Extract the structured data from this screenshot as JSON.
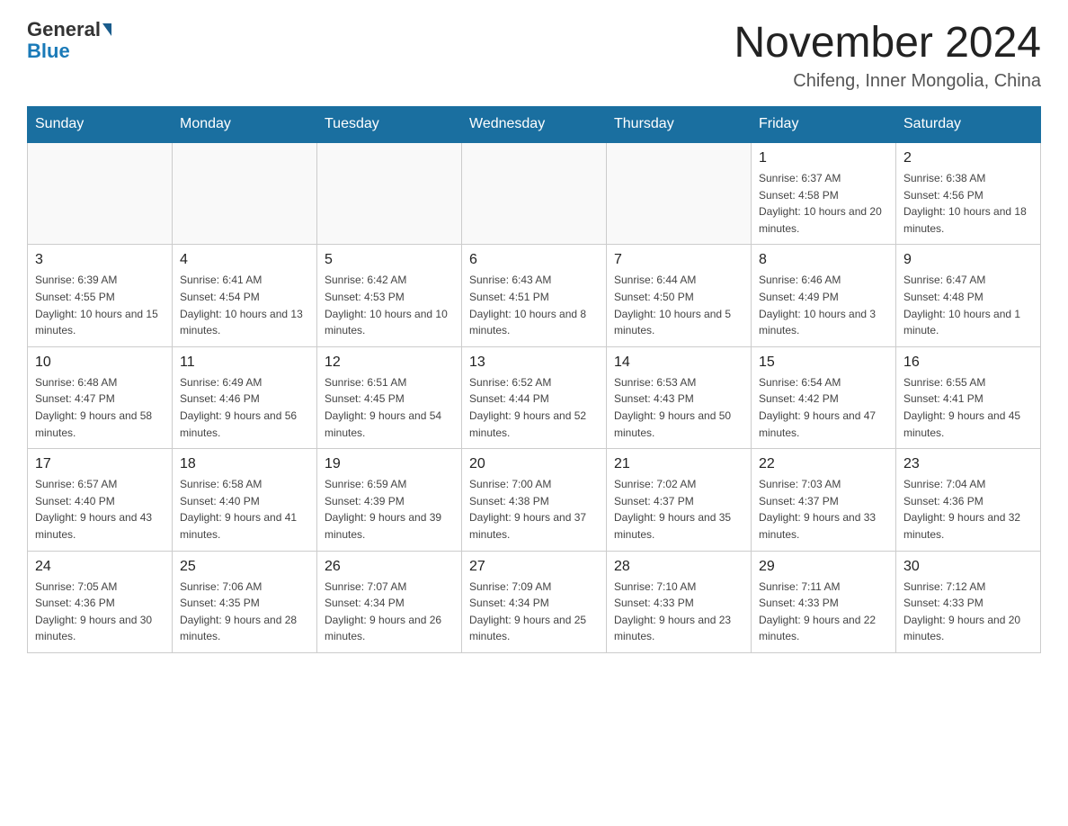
{
  "header": {
    "logo_general": "General",
    "logo_blue": "Blue",
    "month": "November 2024",
    "location": "Chifeng, Inner Mongolia, China"
  },
  "days_of_week": [
    "Sunday",
    "Monday",
    "Tuesday",
    "Wednesday",
    "Thursday",
    "Friday",
    "Saturday"
  ],
  "weeks": [
    [
      {
        "day": "",
        "info": ""
      },
      {
        "day": "",
        "info": ""
      },
      {
        "day": "",
        "info": ""
      },
      {
        "day": "",
        "info": ""
      },
      {
        "day": "",
        "info": ""
      },
      {
        "day": "1",
        "info": "Sunrise: 6:37 AM\nSunset: 4:58 PM\nDaylight: 10 hours and 20 minutes."
      },
      {
        "day": "2",
        "info": "Sunrise: 6:38 AM\nSunset: 4:56 PM\nDaylight: 10 hours and 18 minutes."
      }
    ],
    [
      {
        "day": "3",
        "info": "Sunrise: 6:39 AM\nSunset: 4:55 PM\nDaylight: 10 hours and 15 minutes."
      },
      {
        "day": "4",
        "info": "Sunrise: 6:41 AM\nSunset: 4:54 PM\nDaylight: 10 hours and 13 minutes."
      },
      {
        "day": "5",
        "info": "Sunrise: 6:42 AM\nSunset: 4:53 PM\nDaylight: 10 hours and 10 minutes."
      },
      {
        "day": "6",
        "info": "Sunrise: 6:43 AM\nSunset: 4:51 PM\nDaylight: 10 hours and 8 minutes."
      },
      {
        "day": "7",
        "info": "Sunrise: 6:44 AM\nSunset: 4:50 PM\nDaylight: 10 hours and 5 minutes."
      },
      {
        "day": "8",
        "info": "Sunrise: 6:46 AM\nSunset: 4:49 PM\nDaylight: 10 hours and 3 minutes."
      },
      {
        "day": "9",
        "info": "Sunrise: 6:47 AM\nSunset: 4:48 PM\nDaylight: 10 hours and 1 minute."
      }
    ],
    [
      {
        "day": "10",
        "info": "Sunrise: 6:48 AM\nSunset: 4:47 PM\nDaylight: 9 hours and 58 minutes."
      },
      {
        "day": "11",
        "info": "Sunrise: 6:49 AM\nSunset: 4:46 PM\nDaylight: 9 hours and 56 minutes."
      },
      {
        "day": "12",
        "info": "Sunrise: 6:51 AM\nSunset: 4:45 PM\nDaylight: 9 hours and 54 minutes."
      },
      {
        "day": "13",
        "info": "Sunrise: 6:52 AM\nSunset: 4:44 PM\nDaylight: 9 hours and 52 minutes."
      },
      {
        "day": "14",
        "info": "Sunrise: 6:53 AM\nSunset: 4:43 PM\nDaylight: 9 hours and 50 minutes."
      },
      {
        "day": "15",
        "info": "Sunrise: 6:54 AM\nSunset: 4:42 PM\nDaylight: 9 hours and 47 minutes."
      },
      {
        "day": "16",
        "info": "Sunrise: 6:55 AM\nSunset: 4:41 PM\nDaylight: 9 hours and 45 minutes."
      }
    ],
    [
      {
        "day": "17",
        "info": "Sunrise: 6:57 AM\nSunset: 4:40 PM\nDaylight: 9 hours and 43 minutes."
      },
      {
        "day": "18",
        "info": "Sunrise: 6:58 AM\nSunset: 4:40 PM\nDaylight: 9 hours and 41 minutes."
      },
      {
        "day": "19",
        "info": "Sunrise: 6:59 AM\nSunset: 4:39 PM\nDaylight: 9 hours and 39 minutes."
      },
      {
        "day": "20",
        "info": "Sunrise: 7:00 AM\nSunset: 4:38 PM\nDaylight: 9 hours and 37 minutes."
      },
      {
        "day": "21",
        "info": "Sunrise: 7:02 AM\nSunset: 4:37 PM\nDaylight: 9 hours and 35 minutes."
      },
      {
        "day": "22",
        "info": "Sunrise: 7:03 AM\nSunset: 4:37 PM\nDaylight: 9 hours and 33 minutes."
      },
      {
        "day": "23",
        "info": "Sunrise: 7:04 AM\nSunset: 4:36 PM\nDaylight: 9 hours and 32 minutes."
      }
    ],
    [
      {
        "day": "24",
        "info": "Sunrise: 7:05 AM\nSunset: 4:36 PM\nDaylight: 9 hours and 30 minutes."
      },
      {
        "day": "25",
        "info": "Sunrise: 7:06 AM\nSunset: 4:35 PM\nDaylight: 9 hours and 28 minutes."
      },
      {
        "day": "26",
        "info": "Sunrise: 7:07 AM\nSunset: 4:34 PM\nDaylight: 9 hours and 26 minutes."
      },
      {
        "day": "27",
        "info": "Sunrise: 7:09 AM\nSunset: 4:34 PM\nDaylight: 9 hours and 25 minutes."
      },
      {
        "day": "28",
        "info": "Sunrise: 7:10 AM\nSunset: 4:33 PM\nDaylight: 9 hours and 23 minutes."
      },
      {
        "day": "29",
        "info": "Sunrise: 7:11 AM\nSunset: 4:33 PM\nDaylight: 9 hours and 22 minutes."
      },
      {
        "day": "30",
        "info": "Sunrise: 7:12 AM\nSunset: 4:33 PM\nDaylight: 9 hours and 20 minutes."
      }
    ]
  ]
}
